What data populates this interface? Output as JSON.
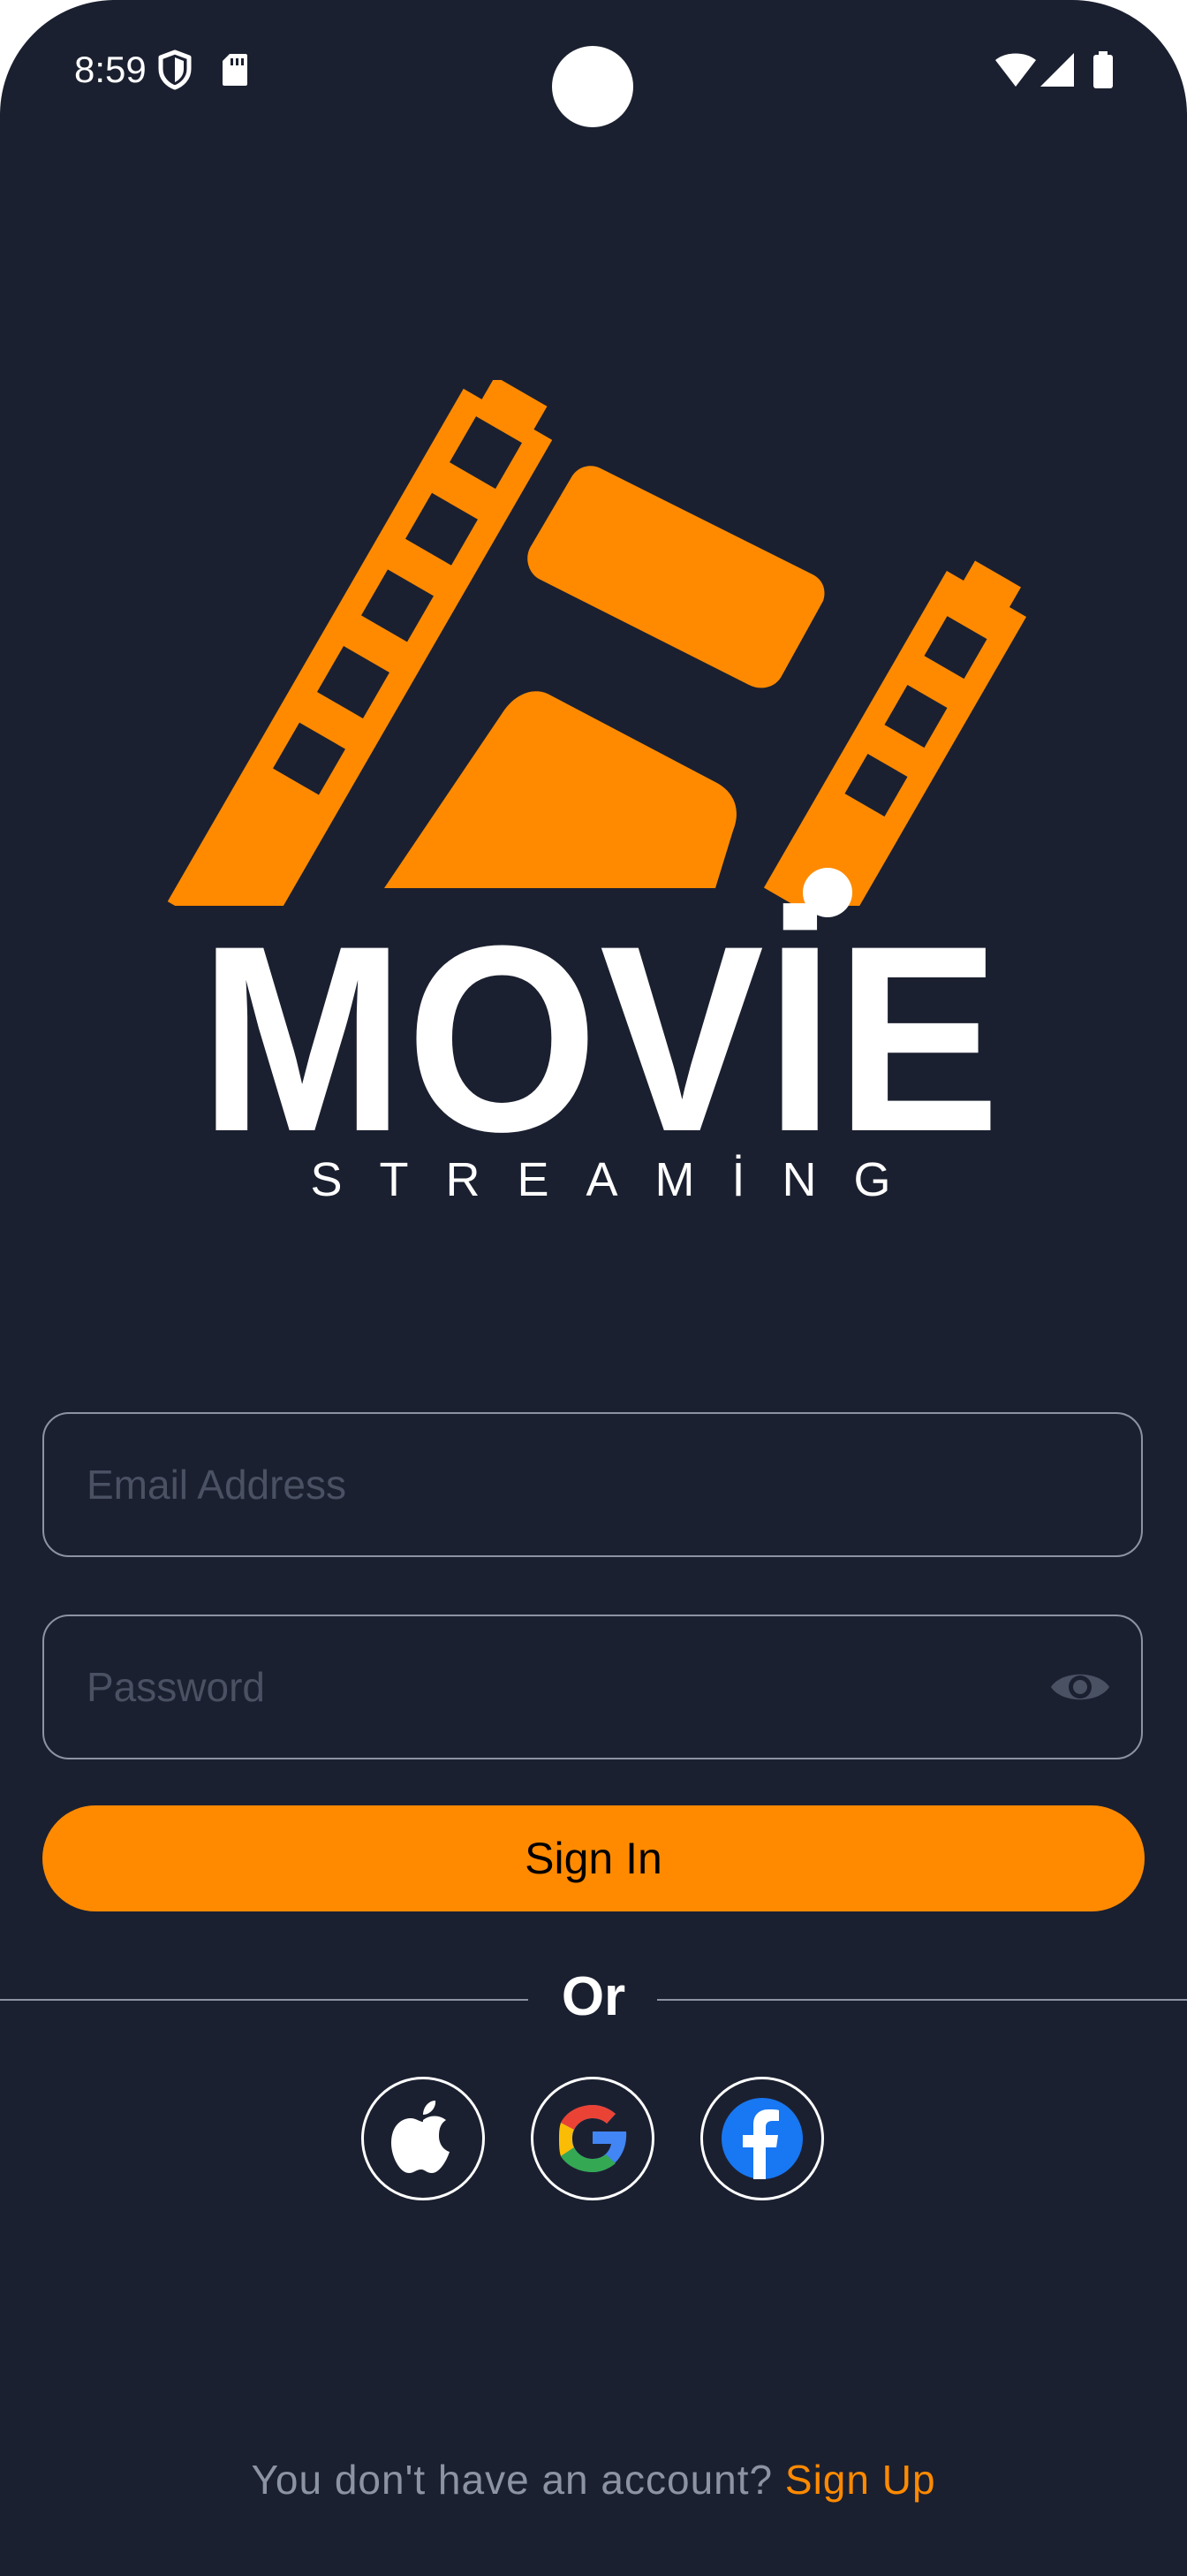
{
  "status_bar": {
    "time": "8:59",
    "icons": [
      "shield-icon",
      "sd-card-icon",
      "wifi-icon",
      "cellular-signal-icon",
      "battery-icon"
    ]
  },
  "logo": {
    "word": "MOVİE",
    "subtitle": "STREAMİNG",
    "icon": "film-strip-icon"
  },
  "form": {
    "email_placeholder": "Email Address",
    "password_placeholder": "Password",
    "password_toggle_icon": "eye-icon",
    "sign_in_label": "Sign In"
  },
  "divider": {
    "label": "Or"
  },
  "social": {
    "buttons": [
      "apple-icon",
      "google-icon",
      "facebook-icon"
    ]
  },
  "footer": {
    "question": "You don't have an account?",
    "link": "Sign Up"
  },
  "colors": {
    "background": "#1b2030",
    "accent": "#ff8a00",
    "border": "#8c93a3",
    "placeholder": "#4a5163"
  }
}
